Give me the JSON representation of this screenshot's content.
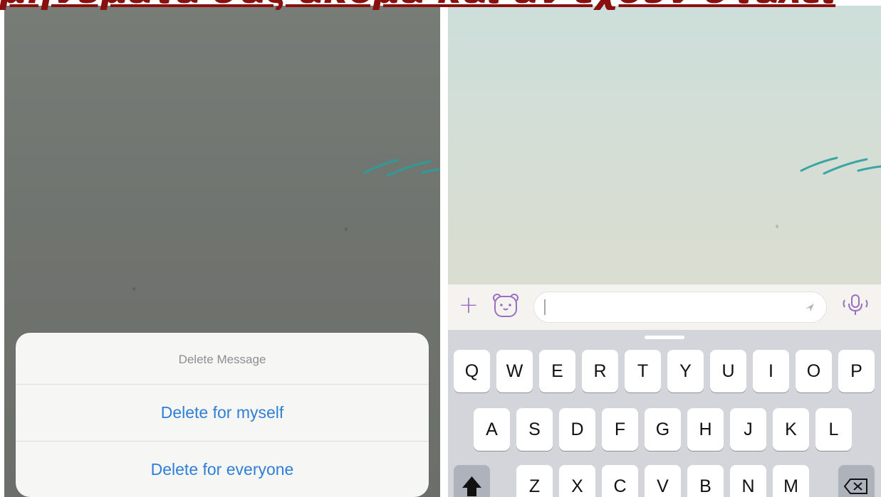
{
  "headline": {
    "text": "μηνύματά σας ακόμα και αν έχουν σταλεί"
  },
  "left_screen": {
    "action_sheet": {
      "title": "Delete Message",
      "options": [
        "Delete for myself",
        "Delete for everyone"
      ]
    }
  },
  "right_screen": {
    "input_bar": {
      "icons": [
        "plus-icon",
        "sticker-icon",
        "send-icon",
        "mic-icon"
      ],
      "message_value": ""
    },
    "keyboard": {
      "row1": [
        "Q",
        "W",
        "E",
        "R",
        "T",
        "Y",
        "U",
        "I",
        "O",
        "P"
      ],
      "row2": [
        "A",
        "S",
        "D",
        "F",
        "G",
        "H",
        "J",
        "K",
        "L"
      ],
      "row3": [
        "Z",
        "X",
        "C",
        "V",
        "B",
        "N",
        "M"
      ],
      "special_keys": [
        "shift-icon",
        "backspace-icon"
      ]
    }
  },
  "colors": {
    "accent_blue": "#2f7fd9",
    "viber_purple": "#9a6fc2",
    "headline_red": "#8a1010",
    "doodle_teal": "#3aa6a4"
  }
}
